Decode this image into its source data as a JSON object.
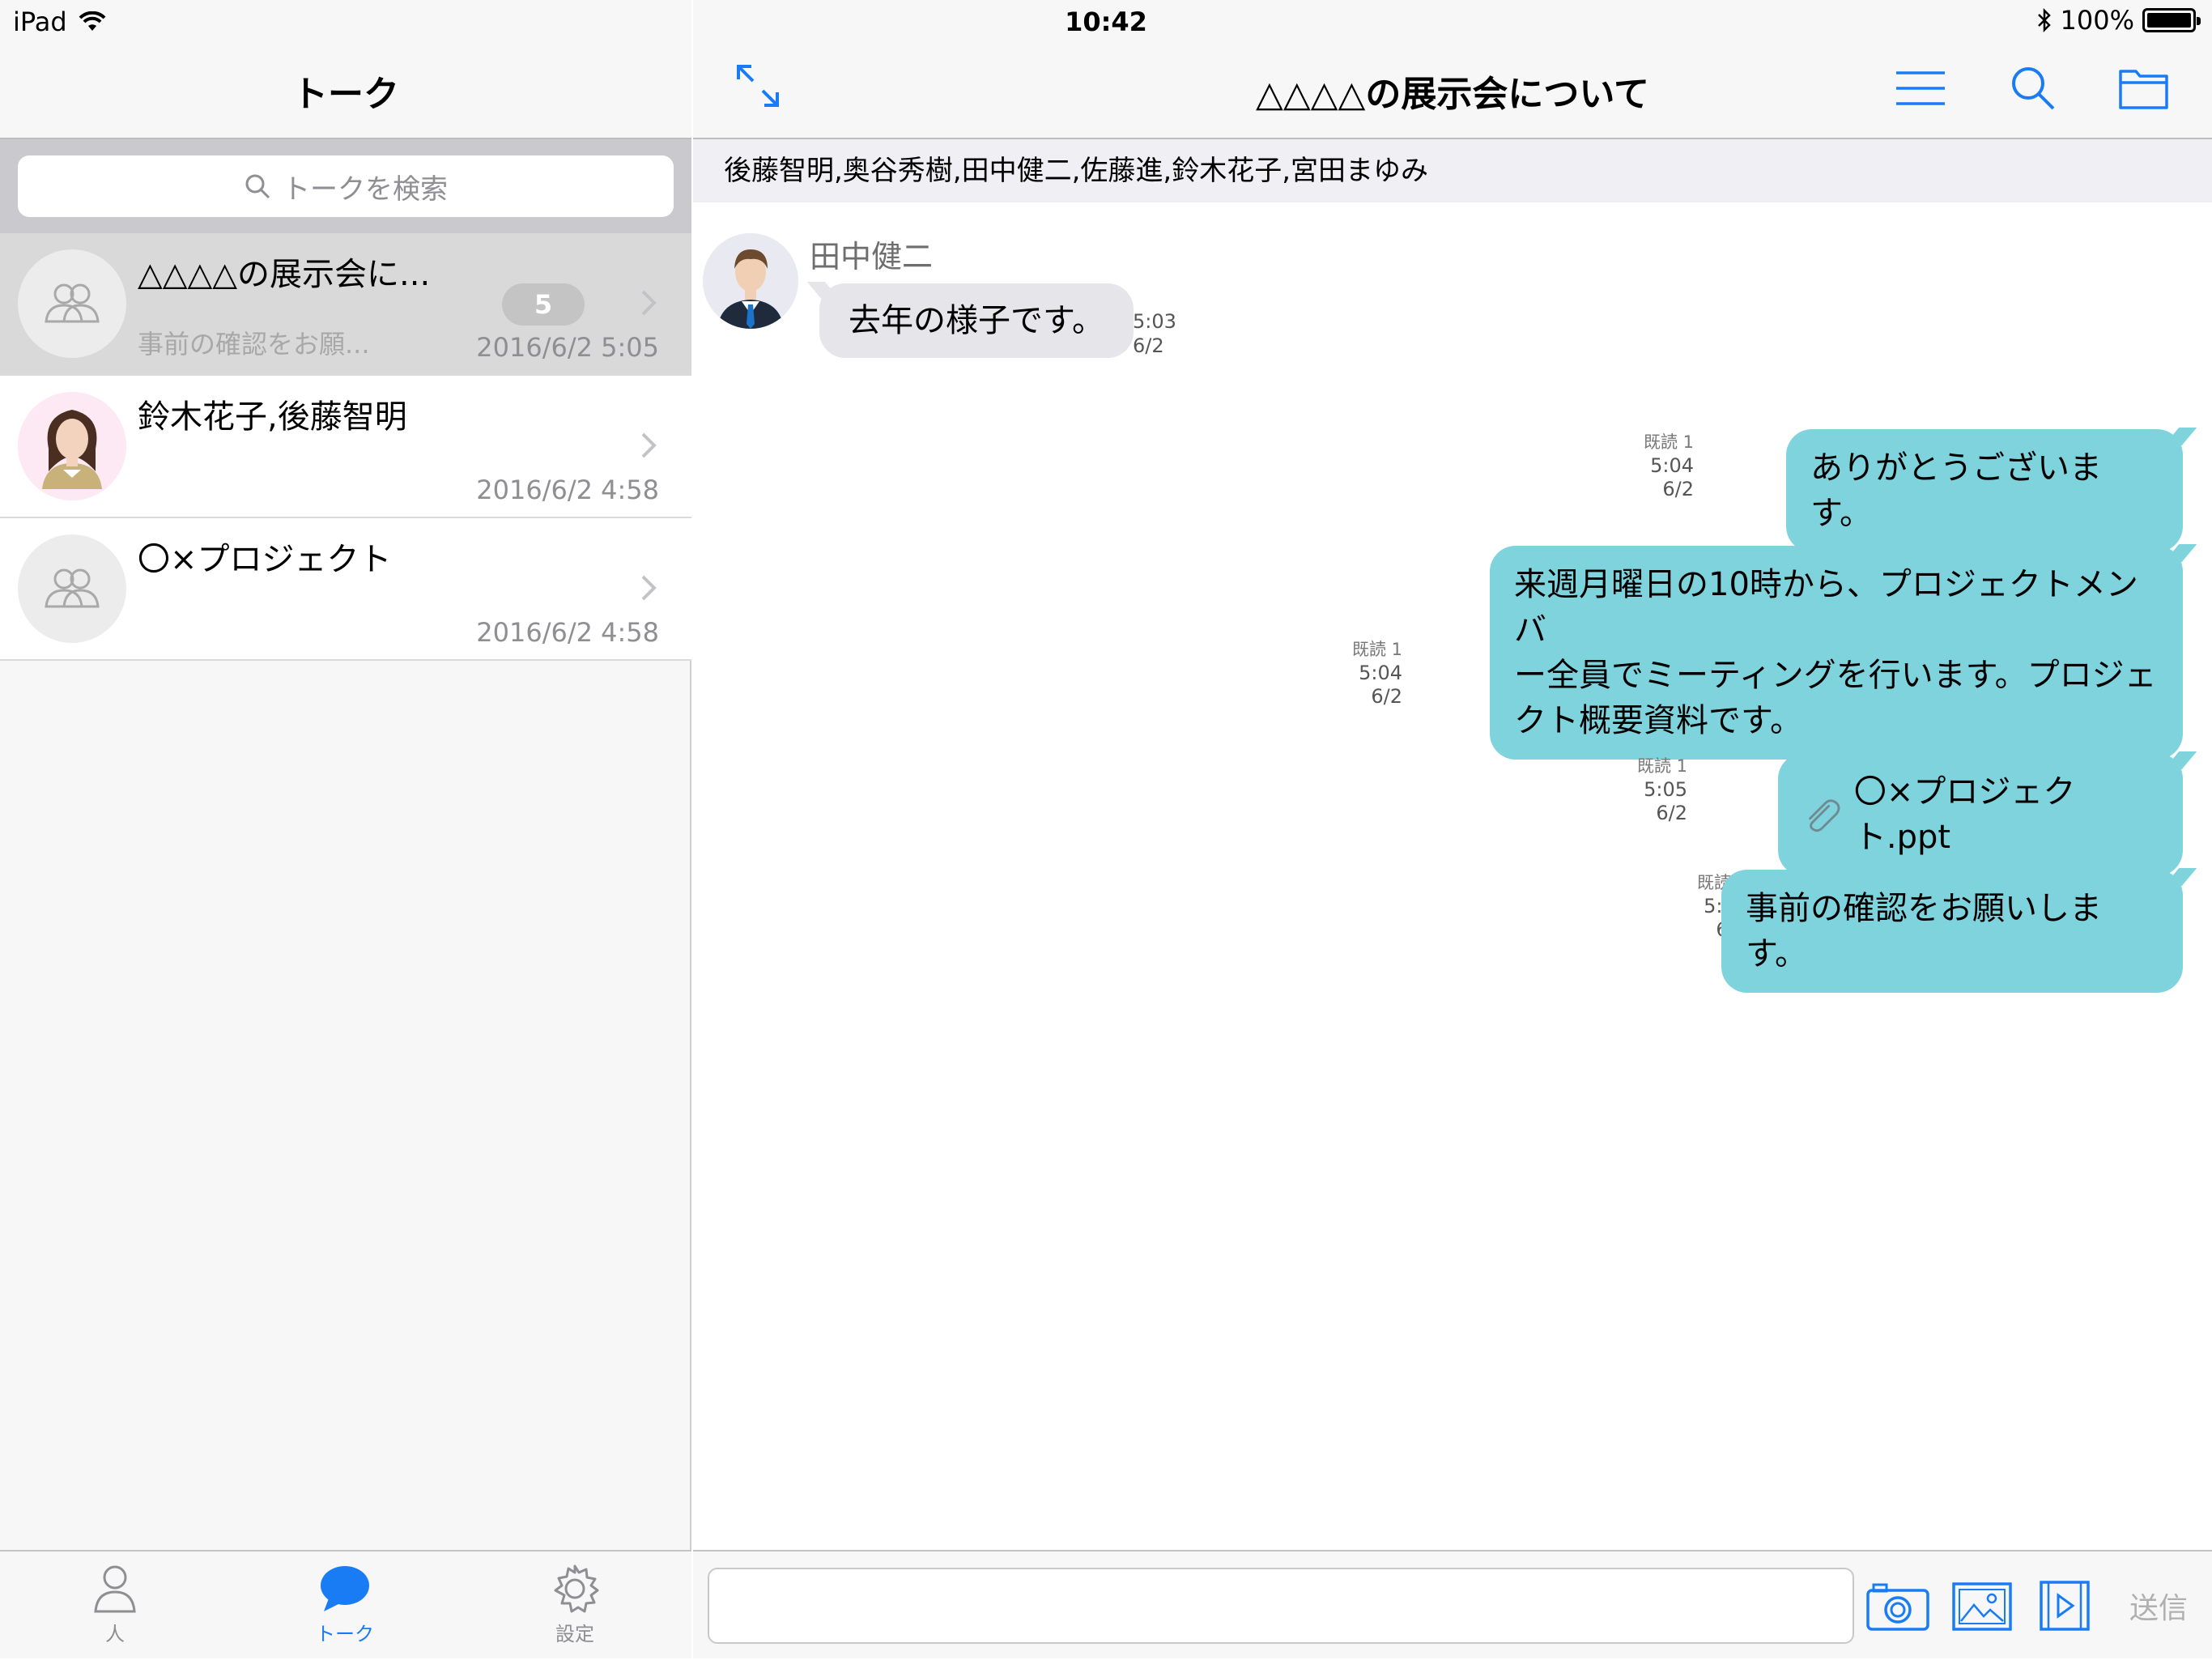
{
  "status_bar": {
    "device": "iPad",
    "time": "10:42",
    "battery": "100%"
  },
  "sidebar": {
    "title": "トーク",
    "search_placeholder": "トークを検索",
    "talks": [
      {
        "name": "△△△△の展示会に...",
        "preview": "事前の確認をお願...",
        "badge": "5",
        "date": "2016/6/2 5:05",
        "avatar": "group-icon"
      },
      {
        "name": "鈴木花子,後藤智明",
        "preview": "",
        "date": "2016/6/2 4:58",
        "avatar": "woman-photo"
      },
      {
        "name": "〇×プロジェクト",
        "preview": "",
        "date": "2016/6/2 4:58",
        "avatar": "group-icon"
      }
    ]
  },
  "tabbar": {
    "tabs": [
      {
        "label": "人",
        "icon": "person-icon"
      },
      {
        "label": "トーク",
        "icon": "chat-bubble-icon",
        "active": true
      },
      {
        "label": "設定",
        "icon": "gear-icon"
      }
    ]
  },
  "chat": {
    "title": "△△△△の展示会について",
    "members": "後藤智明,奥谷秀樹,田中健二,佐藤進,鈴木花子,宮田まゆみ",
    "incoming": {
      "sender": "田中健二",
      "text": "去年の様子です。",
      "time": "5:03",
      "date": "6/2"
    },
    "outgoing": [
      {
        "read": "既読 1",
        "time": "5:04",
        "date": "6/2",
        "text": "ありがとうございます。"
      },
      {
        "read": "既読 1",
        "time": "5:04",
        "date": "6/2",
        "lines": [
          "来週月曜日の10時から、プロジェクトメンバ",
          "ー全員でミーティングを行います。プロジェ",
          "クト概要資料です。"
        ]
      },
      {
        "read": "既読 1",
        "time": "5:05",
        "date": "6/2",
        "text": "〇×プロジェクト.ppt",
        "attachment": true
      },
      {
        "read": "既読 1",
        "time": "5:05",
        "date": "6/2",
        "text": "事前の確認をお願いします。"
      }
    ]
  },
  "input": {
    "value": "",
    "send_label": "送信"
  },
  "colors": {
    "accent": "#1a7cf5",
    "outgoing_bubble": "#7fd3dd",
    "incoming_bubble": "#e5e5ea",
    "selected_row": "#d9d9d9"
  }
}
